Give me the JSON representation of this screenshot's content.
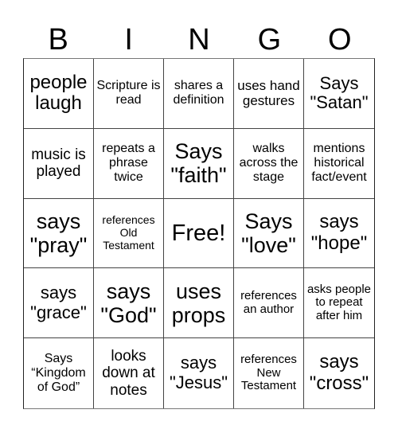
{
  "header": {
    "letters": [
      "B",
      "I",
      "N",
      "G",
      "O"
    ]
  },
  "cells": [
    {
      "text": "people laugh",
      "size": "s24"
    },
    {
      "text": "Scripture is read",
      "size": "s16"
    },
    {
      "text": "shares a definition",
      "size": "s16"
    },
    {
      "text": "uses hand gestures",
      "size": "s17"
    },
    {
      "text": "Says \"Satan\"",
      "size": "s22"
    },
    {
      "text": "music is played",
      "size": "s19"
    },
    {
      "text": "repeats a phrase twice",
      "size": "s16"
    },
    {
      "text": "Says \"faith\"",
      "size": "s27"
    },
    {
      "text": "walks across the stage",
      "size": "s16"
    },
    {
      "text": "mentions historical fact/event",
      "size": "s16"
    },
    {
      "text": "says \"pray\"",
      "size": "s27"
    },
    {
      "text": "references Old Testament",
      "size": "s14"
    },
    {
      "text": "Free!",
      "size": "s29"
    },
    {
      "text": "Says \"love\"",
      "size": "s27"
    },
    {
      "text": "says \"hope\"",
      "size": "s24"
    },
    {
      "text": "says \"grace\"",
      "size": "s22"
    },
    {
      "text": "says \"God\"",
      "size": "s27"
    },
    {
      "text": "uses props",
      "size": "s27"
    },
    {
      "text": "references an author",
      "size": "s15"
    },
    {
      "text": "asks people to repeat after him",
      "size": "s15"
    },
    {
      "text": "Says “Kingdom of God”",
      "size": "s16"
    },
    {
      "text": "looks down at notes",
      "size": "s19"
    },
    {
      "text": "says \"Jesus\"",
      "size": "s22"
    },
    {
      "text": "references New Testament",
      "size": "s15"
    },
    {
      "text": "says \"cross\"",
      "size": "s24"
    }
  ]
}
